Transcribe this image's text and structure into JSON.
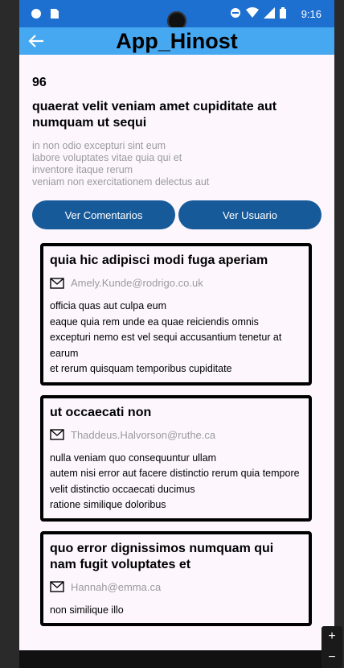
{
  "status_bar": {
    "time": "9:16"
  },
  "app_bar": {
    "title": "App_Hinost"
  },
  "post": {
    "id": "96",
    "title": "quaerat velit veniam amet cupiditate aut numquam ut sequi",
    "body_lines": [
      "in non odio excepturi sint eum",
      "labore voluptates vitae quia qui et",
      "inventore itaque rerum",
      "veniam non exercitationem delectus aut"
    ]
  },
  "buttons": {
    "comments": "Ver Comentarios",
    "user": "Ver Usuario"
  },
  "comments": [
    {
      "name": "quia hic adipisci modi fuga aperiam",
      "email": "Amely.Kunde@rodrigo.co.uk",
      "body_lines": [
        "officia quas aut culpa eum",
        "eaque quia rem unde ea quae reiciendis omnis",
        "excepturi nemo est vel sequi accusantium tenetur at earum",
        "et rerum quisquam temporibus cupiditate"
      ]
    },
    {
      "name": "ut occaecati non",
      "email": "Thaddeus.Halvorson@ruthe.ca",
      "body_lines": [
        "nulla veniam quo consequuntur ullam",
        "autem nisi error aut facere distinctio rerum quia tempore",
        "velit distinctio occaecati ducimus",
        "ratione similique doloribus"
      ]
    },
    {
      "name": "quo error dignissimos numquam qui nam fugit voluptates et",
      "email": "Hannah@emma.ca",
      "body_lines": [
        "non similique illo"
      ]
    }
  ],
  "zoom": {
    "plus": "+",
    "minus": "−"
  },
  "icons": {
    "back": "arrow-left-icon",
    "email": "envelope-icon"
  },
  "colors": {
    "status_bar": "#1d6fd0",
    "app_bar": "#46a8f0",
    "button": "#175a9a",
    "background": "#fdf7fd"
  }
}
